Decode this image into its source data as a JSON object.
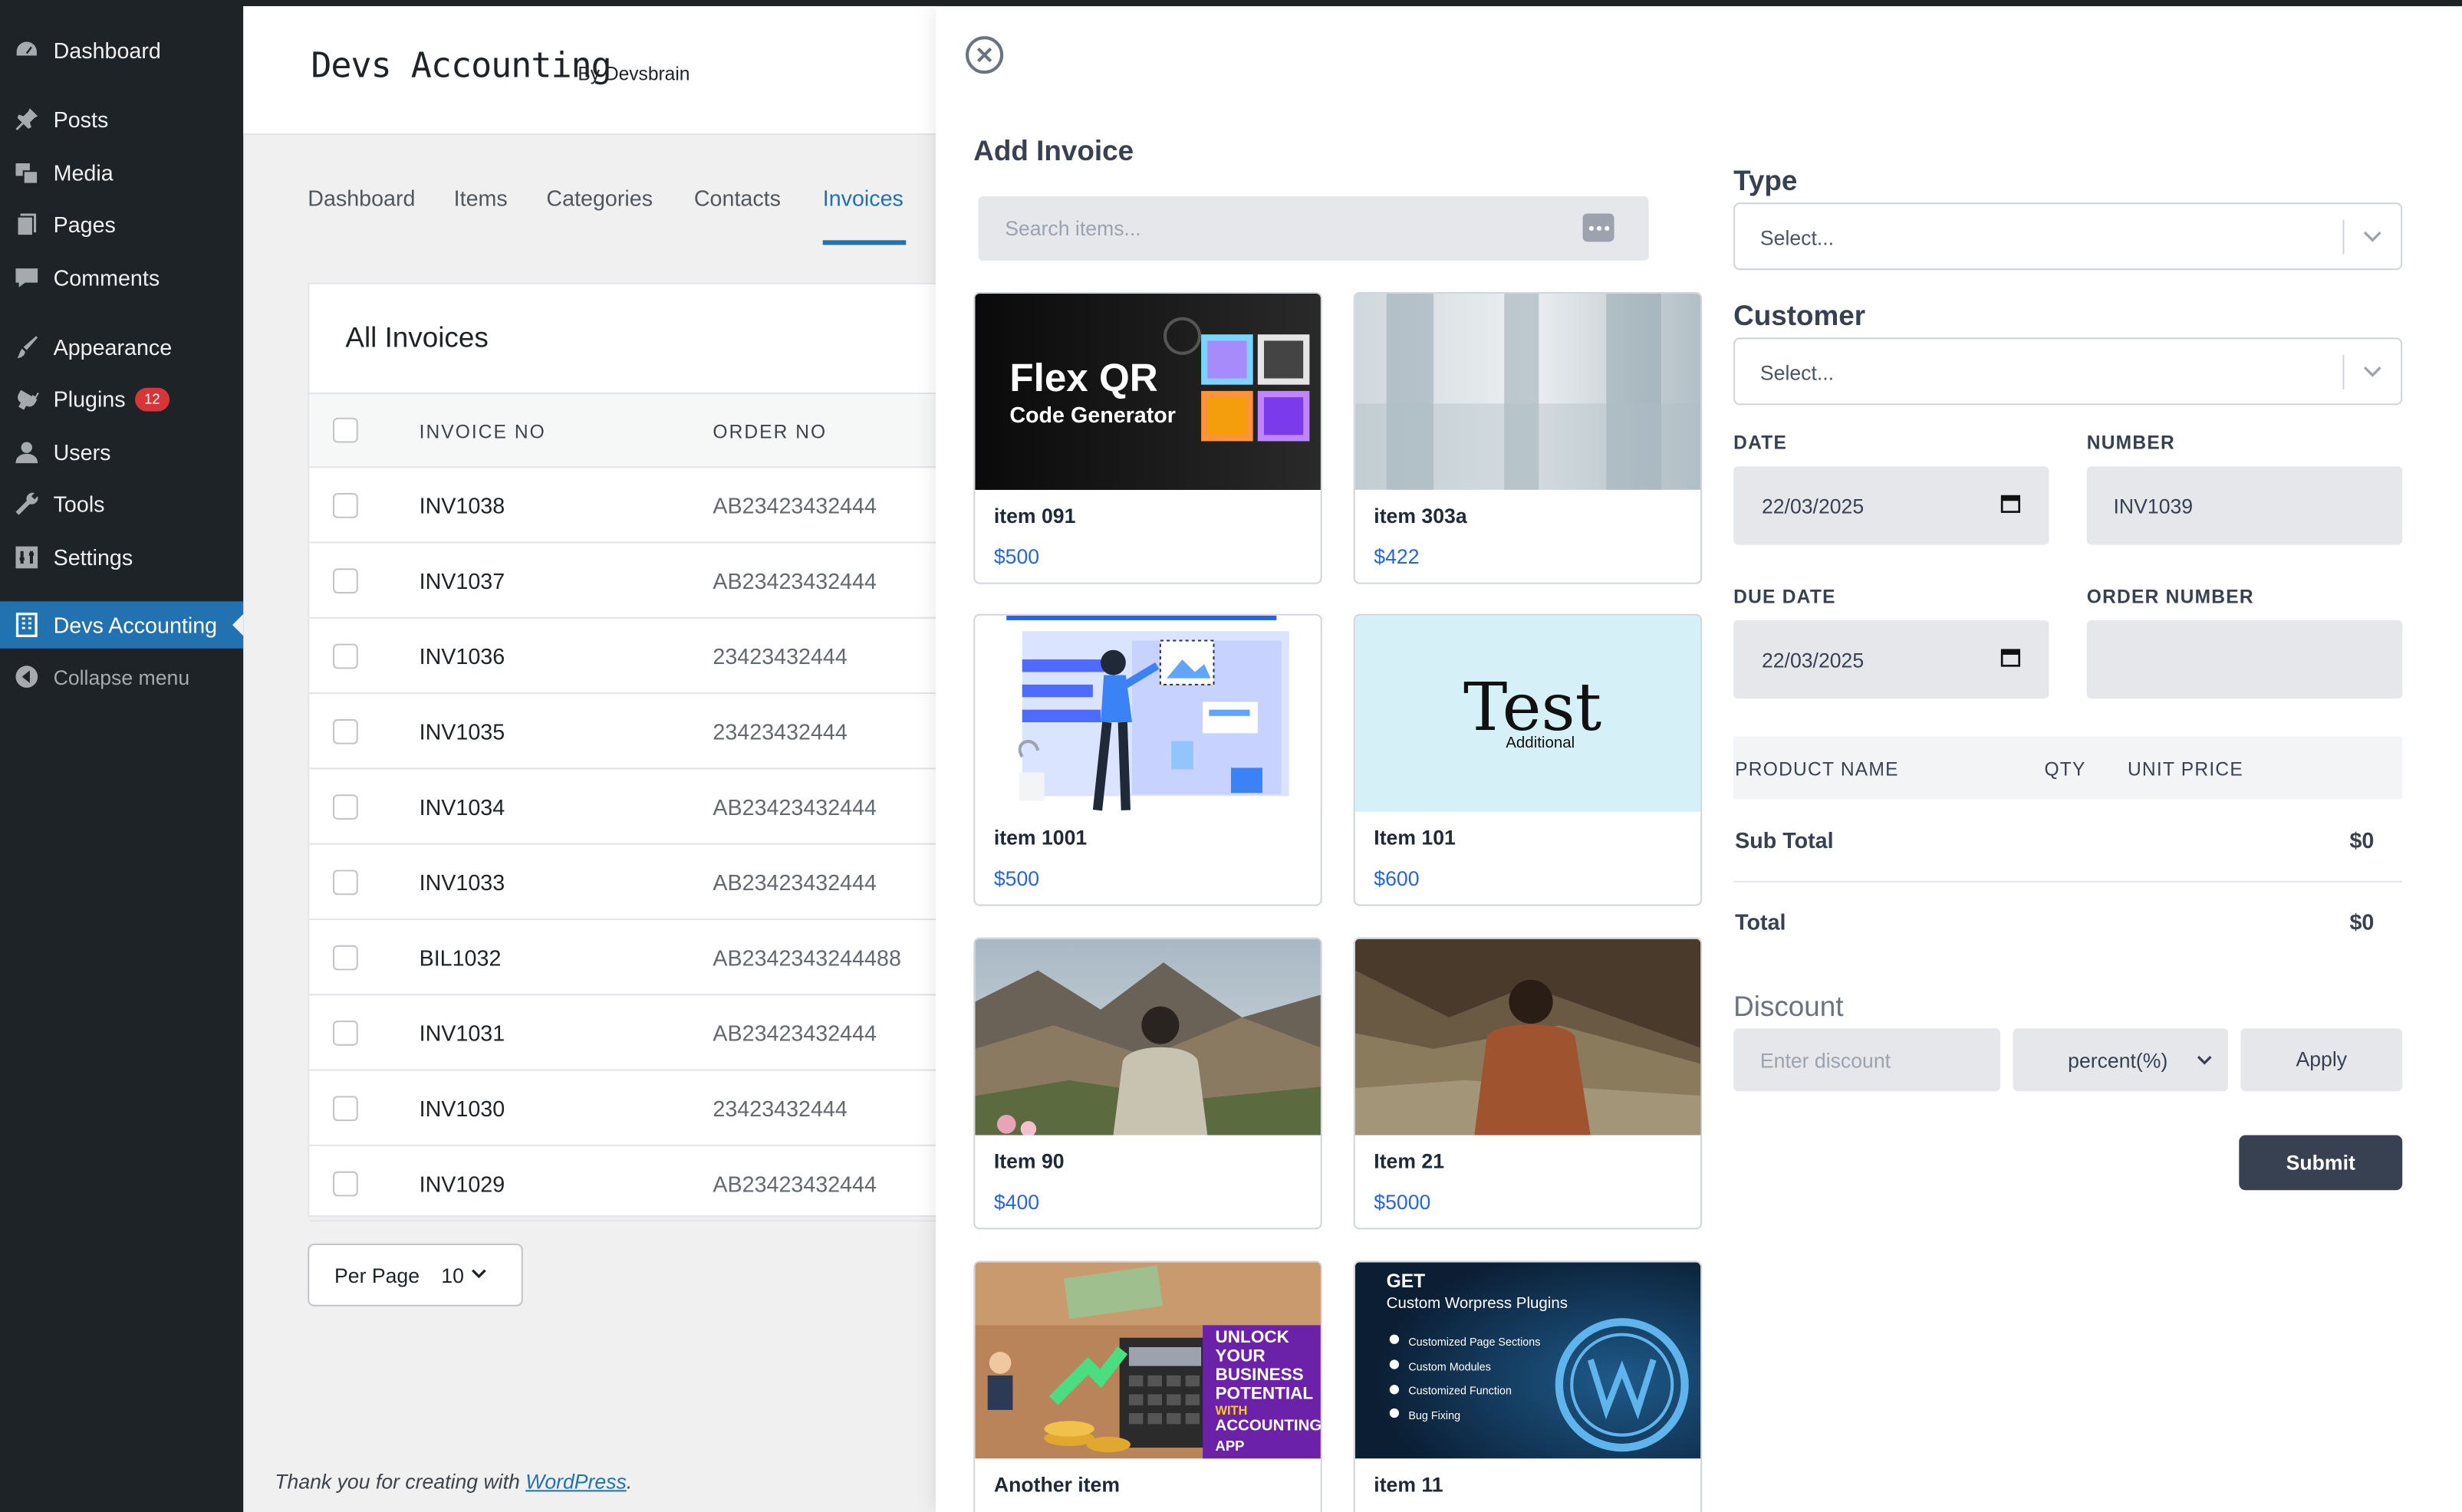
{
  "wp_menu": [
    {
      "label": "Dashboard",
      "icon": "dashboard-icon"
    },
    {
      "label": "Posts",
      "icon": "pin-icon"
    },
    {
      "label": "Media",
      "icon": "media-icon"
    },
    {
      "label": "Pages",
      "icon": "pages-icon"
    },
    {
      "label": "Comments",
      "icon": "comment-icon"
    },
    {
      "label": "Appearance",
      "icon": "brush-icon"
    },
    {
      "label": "Plugins",
      "icon": "plugin-icon",
      "badge": "12"
    },
    {
      "label": "Users",
      "icon": "user-icon"
    },
    {
      "label": "Tools",
      "icon": "wrench-icon"
    },
    {
      "label": "Settings",
      "icon": "settings-icon"
    },
    {
      "label": "Devs Accounting",
      "icon": "building-icon",
      "active": true
    },
    {
      "label": "Collapse menu",
      "icon": "collapse-icon"
    }
  ],
  "app": {
    "title": "Devs Accounting",
    "by": "By Devsbrain"
  },
  "tabs": [
    "Dashboard",
    "Items",
    "Categories",
    "Contacts",
    "Invoices"
  ],
  "active_tab": "Invoices",
  "invoices": {
    "title": "All Invoices",
    "columns": [
      "INVOICE NO",
      "ORDER NO"
    ],
    "rows": [
      {
        "invoice": "INV1038",
        "order": "AB23423432444"
      },
      {
        "invoice": "INV1037",
        "order": "AB23423432444"
      },
      {
        "invoice": "INV1036",
        "order": "23423432444"
      },
      {
        "invoice": "INV1035",
        "order": "23423432444"
      },
      {
        "invoice": "INV1034",
        "order": "AB23423432444"
      },
      {
        "invoice": "INV1033",
        "order": "AB23423432444"
      },
      {
        "invoice": "BIL1032",
        "order": "AB2342343244488"
      },
      {
        "invoice": "INV1031",
        "order": "AB23423432444"
      },
      {
        "invoice": "INV1030",
        "order": "23423432444"
      },
      {
        "invoice": "INV1029",
        "order": "AB23423432444"
      }
    ],
    "per_page_label": "Per Page",
    "per_page_value": "10"
  },
  "footer": {
    "text": "Thank you for creating with ",
    "link": "WordPress",
    "end": "."
  },
  "drawer": {
    "title": "Add Invoice",
    "search_placeholder": "Search items...",
    "items": [
      {
        "name": "item 091",
        "price": "$500",
        "image_text_1": "Flex QR",
        "image_text_2": "Code Generator"
      },
      {
        "name": "item 303a",
        "price": "$422"
      },
      {
        "name": "item 1001",
        "price": "$500"
      },
      {
        "name": "Item 101",
        "price": "$600",
        "image_text_1": "Test",
        "image_text_2": "Additional"
      },
      {
        "name": "Item 90",
        "price": "$400"
      },
      {
        "name": "Item 21",
        "price": "$5000"
      },
      {
        "name": "Another item",
        "image_lines": [
          "UNLOCK",
          "YOUR",
          "BUSINESS",
          "POTENTIAL",
          "WITH",
          "ACCOUNTING",
          "APP"
        ]
      },
      {
        "name": "item 11",
        "image_text_1": "GET",
        "image_text_2": "Custom Worpress Plugins",
        "image_list": [
          "Customized Page Sections",
          "Custom Modules",
          "Customized Function",
          "Bug Fixing"
        ]
      }
    ],
    "form": {
      "type_label": "Type",
      "type_placeholder": "Select...",
      "customer_label": "Customer",
      "customer_placeholder": "Select...",
      "date_label": "DATE",
      "date_value": "22/03/2025",
      "number_label": "NUMBER",
      "number_value": "INV1039",
      "due_date_label": "DUE DATE",
      "due_date_value": "22/03/2025",
      "order_number_label": "ORDER NUMBER",
      "order_number_value": "",
      "product_columns": [
        "PRODUCT NAME",
        "QTY",
        "UNIT PRICE"
      ],
      "subtotal_label": "Sub Total",
      "subtotal_value": "$0",
      "total_label": "Total",
      "total_value": "$0",
      "discount_label": "Discount",
      "discount_placeholder": "Enter discount",
      "discount_type": "percent(%)",
      "apply_label": "Apply",
      "submit_label": "Submit"
    }
  },
  "colors": {
    "wp_sidebar": "#1d2327",
    "wp_active": "#2271b1",
    "price": "#2563eb",
    "submit": "#374151"
  }
}
